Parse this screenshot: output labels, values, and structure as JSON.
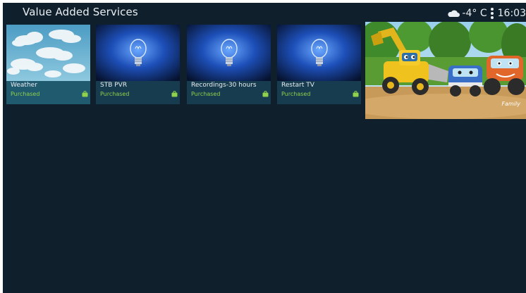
{
  "header": {
    "title": "Value Added Services",
    "temperature": "-4° C",
    "time": "16:03",
    "weather_icon": "cloud-icon",
    "menu_icon": "kebab-menu-icon"
  },
  "tiles": [
    {
      "name": "Weather",
      "status": "Purchased",
      "art": "sky-clouds",
      "focused": true
    },
    {
      "name": "STB PVR",
      "status": "Purchased",
      "art": "lightbulb"
    },
    {
      "name": "Recordings-30 hours",
      "status": "Purchased",
      "art": "lightbulb"
    },
    {
      "name": "Restart TV",
      "status": "Purchased",
      "art": "lightbulb"
    }
  ],
  "preview": {
    "channel_logo": "Family"
  },
  "colors": {
    "background": "#0f1f2c",
    "tile": "#173b4f",
    "tile_focused": "#1f5a6f",
    "purchased": "#8fd04c"
  }
}
